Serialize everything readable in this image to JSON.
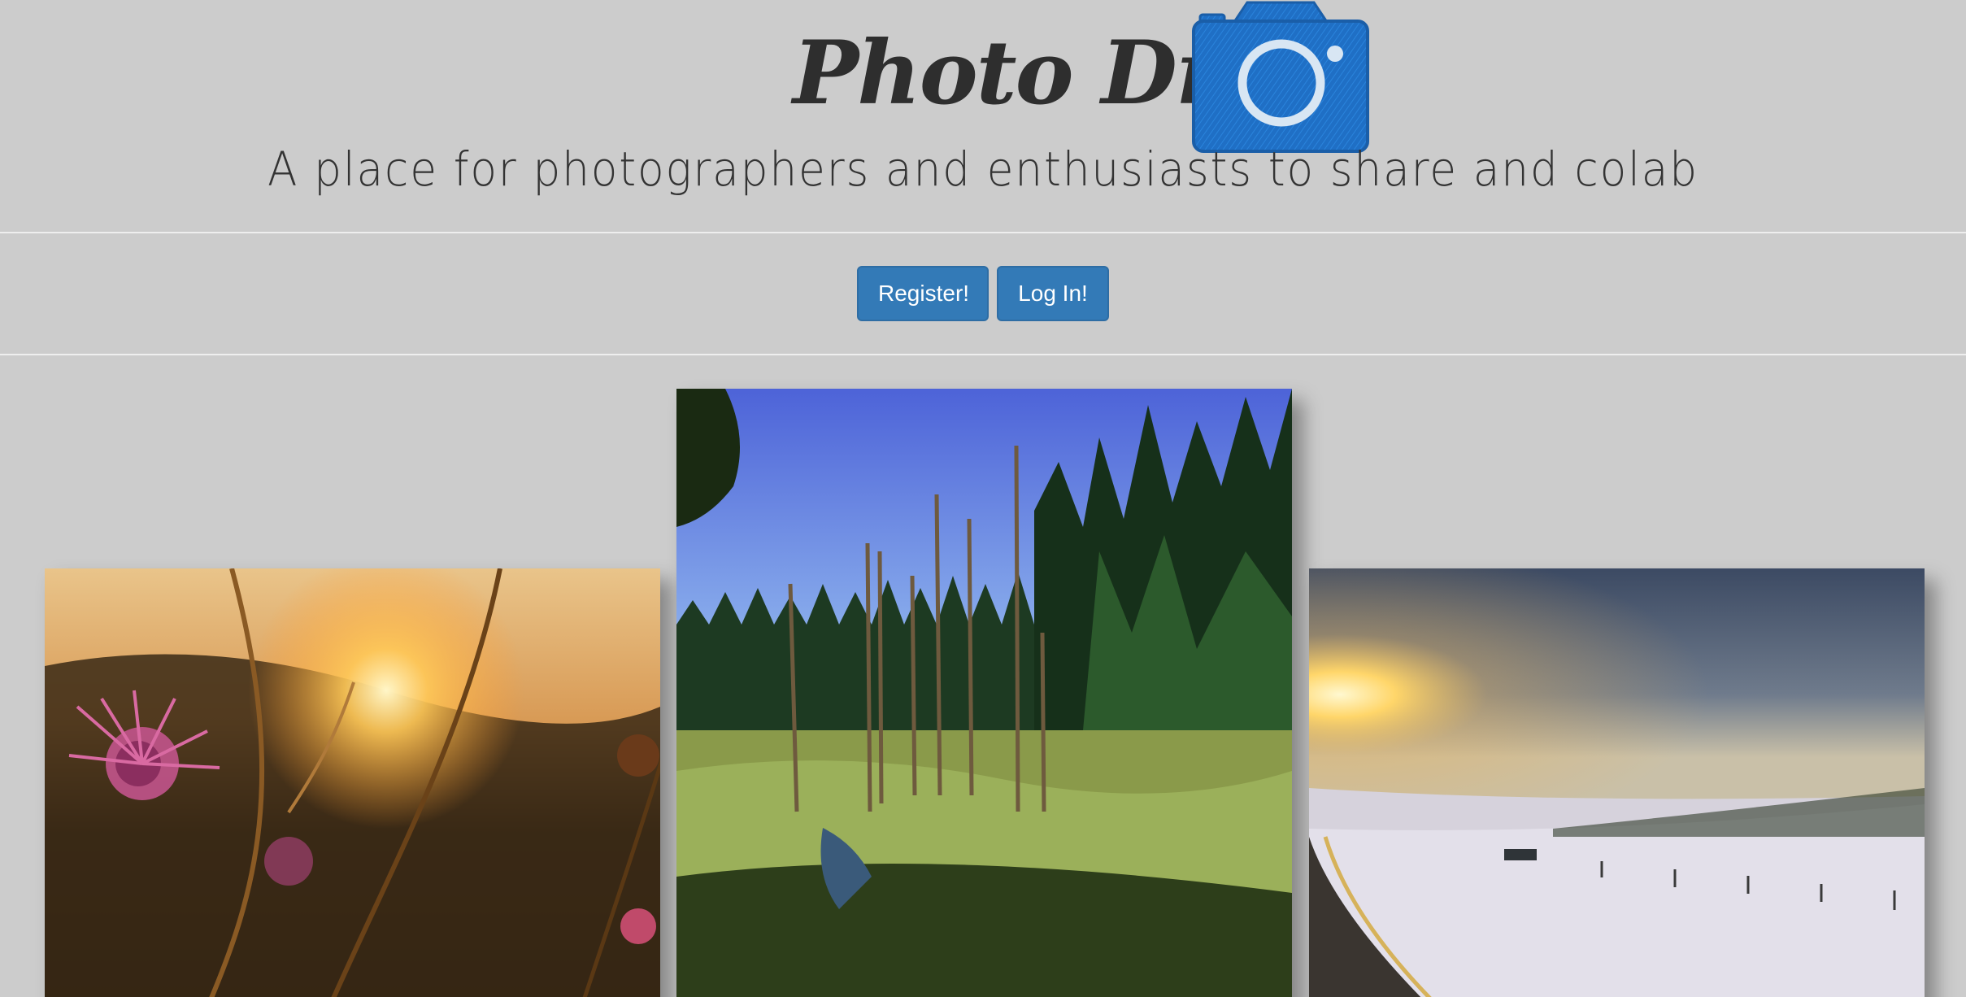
{
  "header": {
    "title": "Photo Drop",
    "tagline": "A place for photographers and enthusiasts to share and colab",
    "logo_icon": "camera-icon",
    "logo_color": "#1f6fc5"
  },
  "auth": {
    "register_label": "Register!",
    "login_label": "Log In!",
    "button_color": "#337ab7"
  },
  "gallery": {
    "photos": [
      {
        "name": "sunset-flowers-photo"
      },
      {
        "name": "forest-marsh-photo"
      },
      {
        "name": "snowy-road-photo"
      }
    ]
  }
}
